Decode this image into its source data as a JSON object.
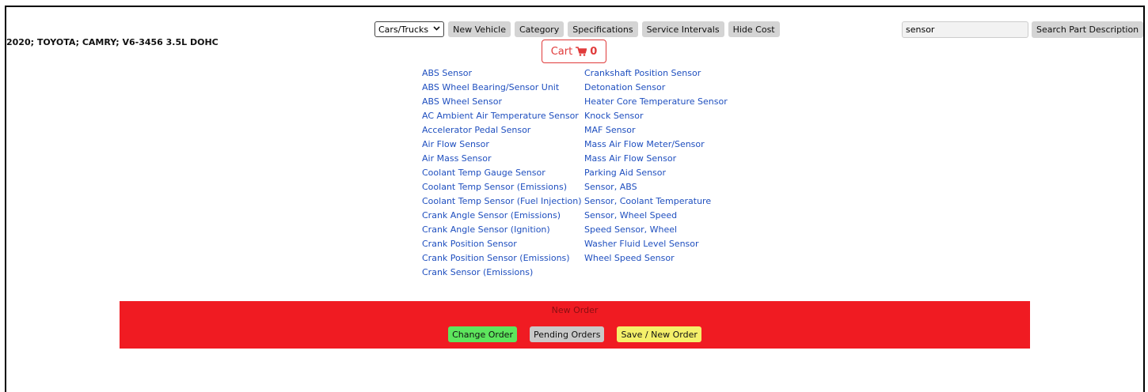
{
  "vehicle": "2020; TOYOTA; CAMRY; V6-3456 3.5L DOHC",
  "toolbar": {
    "type_select": "Cars/Trucks",
    "buttons": [
      "New Vehicle",
      "Category",
      "Specifications",
      "Service Intervals",
      "Hide Cost"
    ]
  },
  "search": {
    "value": "sensor",
    "button_label": "Search Part Description"
  },
  "cart": {
    "label": "Cart",
    "count": "0",
    "accent": "#e03a3a"
  },
  "results": {
    "column1": [
      "ABS Sensor",
      "ABS Wheel Bearing/Sensor Unit",
      "ABS Wheel Sensor",
      "AC Ambient Air Temperature Sensor",
      "Accelerator Pedal Sensor",
      "Air Flow Sensor",
      "Air Mass Sensor",
      "Coolant Temp Gauge Sensor",
      "Coolant Temp Sensor (Emissions)",
      "Coolant Temp Sensor (Fuel Injection)",
      "Crank Angle Sensor (Emissions)",
      "Crank Angle Sensor (Ignition)",
      "Crank Position Sensor",
      "Crank Position Sensor (Emissions)",
      "Crank Sensor (Emissions)"
    ],
    "column2": [
      "Crankshaft Position Sensor",
      "Detonation Sensor",
      "Heater Core Temperature Sensor",
      "Knock Sensor",
      "MAF Sensor",
      "Mass Air Flow Meter/Sensor",
      "Mass Air Flow Sensor",
      "Parking Aid Sensor",
      "Sensor, ABS",
      "Sensor, Coolant Temperature",
      "Sensor, Wheel Speed",
      "Speed Sensor, Wheel",
      "Washer Fluid Level Sensor",
      "Wheel Speed Sensor"
    ]
  },
  "order": {
    "title": "New Order",
    "panel_color": "#f01b22",
    "change_order": "Change Order",
    "pending_orders": "Pending Orders",
    "save_new_order": "Save / New Order"
  },
  "icons": {
    "cart": "shopping-cart-icon",
    "select": "chevron-down-icon"
  }
}
